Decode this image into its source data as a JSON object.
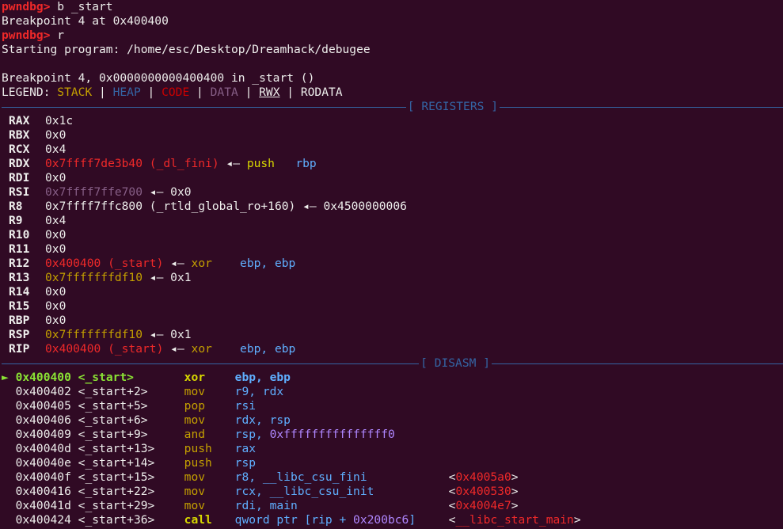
{
  "session": {
    "prompt": "pwndbg>",
    "cmd1": " b _start",
    "out1": "Breakpoint 4 at 0x400400",
    "cmd2": " r",
    "out2": "Starting program: /home/esc/Desktop/Dreamhack/debugee",
    "out3": "Breakpoint 4, 0x0000000000400400 in _start ()"
  },
  "legend": {
    "prefix": "LEGEND: ",
    "stack": "STACK",
    "heap": "HEAP",
    "code": "CODE",
    "data": "DATA",
    "rwx": "RWX",
    "rodata": "RODATA",
    "sep": " | "
  },
  "sections": {
    "registers": "[ REGISTERS ]",
    "disasm": "[ DISASM ]"
  },
  "registers": [
    {
      "name": "RAX",
      "value": "0x1c"
    },
    {
      "name": "RBX",
      "value": "0x0"
    },
    {
      "name": "RCX",
      "value": "0x4"
    },
    {
      "name": "RDX",
      "value": "0x7ffff7de3b40 (_dl_fini)",
      "arrow": " ◂— ",
      "tail1": "push",
      "tail2": "rbp"
    },
    {
      "name": "RDI",
      "value": "0x0"
    },
    {
      "name": "RSI",
      "value": "0x7ffff7ffe700",
      "arrow": " ◂— ",
      "tail1": "0x0"
    },
    {
      "name": "R8",
      "value": "0x7ffff7ffc800 (_rtld_global_ro+160)",
      "arrow": " ◂— ",
      "tail1": "0x4500000006"
    },
    {
      "name": "R9",
      "value": "0x4"
    },
    {
      "name": "R10",
      "value": "0x0"
    },
    {
      "name": "R11",
      "value": "0x0"
    },
    {
      "name": "R12",
      "value": "0x400400 (_start)",
      "arrow": " ◂— ",
      "tail1": "xor",
      "tail2": "ebp, ebp"
    },
    {
      "name": "R13",
      "value": "0x7fffffffdf10",
      "arrow": " ◂— ",
      "tail1": "0x1"
    },
    {
      "name": "R14",
      "value": "0x0"
    },
    {
      "name": "R15",
      "value": "0x0"
    },
    {
      "name": "RBP",
      "value": "0x0"
    },
    {
      "name": "RSP",
      "value": "0x7fffffffdf10",
      "arrow": " ◂— ",
      "tail1": "0x1"
    },
    {
      "name": "RIP",
      "value": "0x400400 (_start)",
      "arrow": " ◂— ",
      "tail1": "xor",
      "tail2": "ebp, ebp"
    }
  ],
  "disasm": [
    {
      "marker": "► ",
      "addr": "0x400400",
      "sym": "<_start>",
      "mn": "xor",
      "op1": "ebp, ebp",
      "op2": "",
      "tgt": ""
    },
    {
      "marker": "  ",
      "addr": "0x400402",
      "sym": "<_start+2>",
      "mn": "mov",
      "op1": "r9, ",
      "op2": "rdx",
      "tgt": ""
    },
    {
      "marker": "  ",
      "addr": "0x400405",
      "sym": "<_start+5>",
      "mn": "pop",
      "op1": "rsi",
      "op2": "",
      "tgt": ""
    },
    {
      "marker": "  ",
      "addr": "0x400406",
      "sym": "<_start+6>",
      "mn": "mov",
      "op1": "rdx, ",
      "op2": "rsp",
      "tgt": ""
    },
    {
      "marker": "  ",
      "addr": "0x400409",
      "sym": "<_start+9>",
      "mn": "and",
      "op1": "rsp, ",
      "op2": "0xfffffffffffffff0",
      "tgt": ""
    },
    {
      "marker": "  ",
      "addr": "0x40040d",
      "sym": "<_start+13>",
      "mn": "push",
      "op1": "rax",
      "op2": "",
      "tgt": ""
    },
    {
      "marker": "  ",
      "addr": "0x40040e",
      "sym": "<_start+14>",
      "mn": "push",
      "op1": "rsp",
      "op2": "",
      "tgt": ""
    },
    {
      "marker": "  ",
      "addr": "0x40040f",
      "sym": "<_start+15>",
      "mn": "mov",
      "op1": "r8, ",
      "op2": "__libc_csu_fini",
      "tgt": "0x4005a0"
    },
    {
      "marker": "  ",
      "addr": "0x400416",
      "sym": "<_start+22>",
      "mn": "mov",
      "op1": "rcx, ",
      "op2": "__libc_csu_init",
      "tgt": "0x400530"
    },
    {
      "marker": "  ",
      "addr": "0x40041d",
      "sym": "<_start+29>",
      "mn": "mov",
      "op1": "rdi, ",
      "op2": "main",
      "tgt": "0x4004e7"
    },
    {
      "marker": "  ",
      "addr": "0x400424",
      "sym": "<_start+36>",
      "mn": "call",
      "op1": "qword ptr [rip + ",
      "op2": "0x200bc6",
      "op3": "]",
      "tgt": "__libc_start_main"
    }
  ],
  "colors": {
    "background": "#300a24",
    "stack": "#c4a000",
    "heap": "#3465a4",
    "code": "#cc0000",
    "data": "#875f87"
  }
}
